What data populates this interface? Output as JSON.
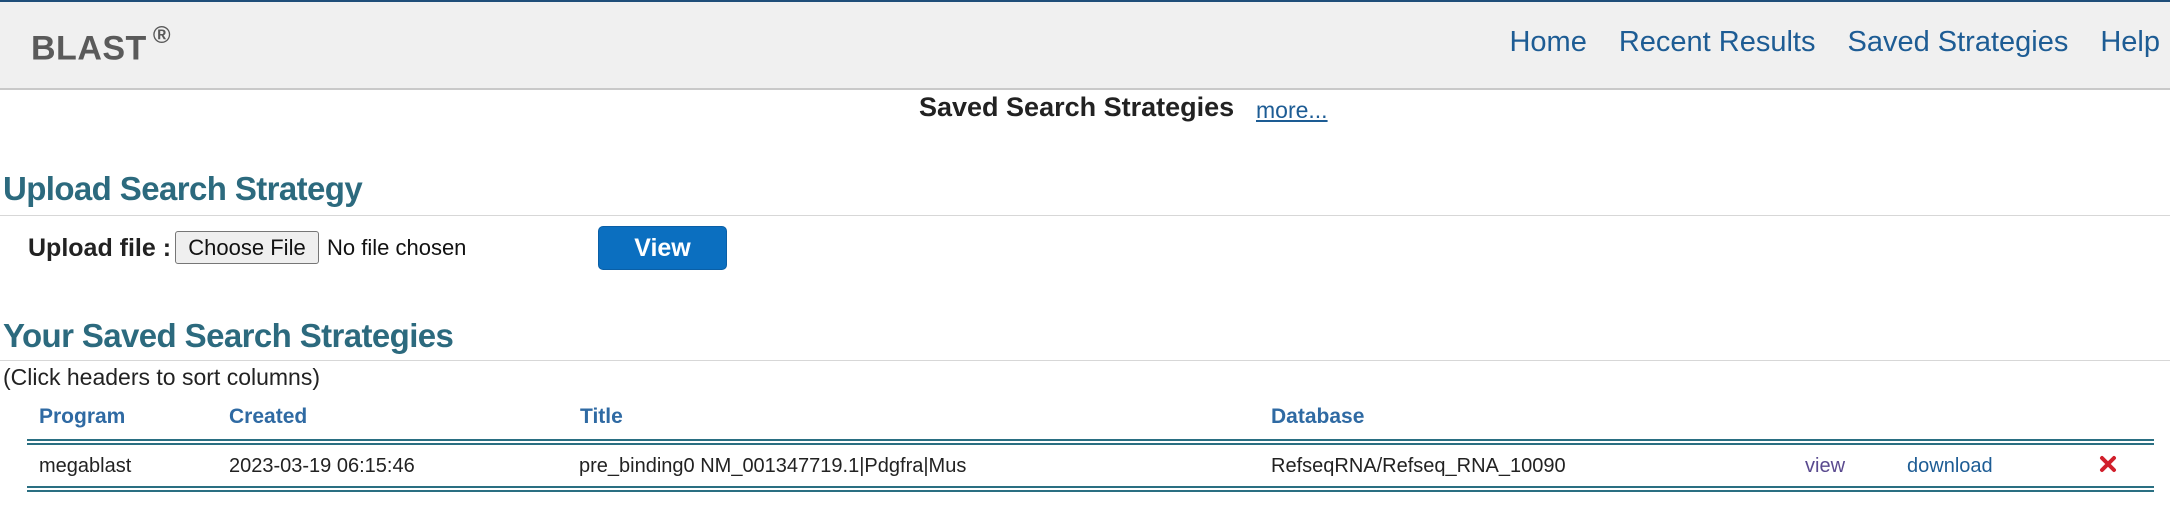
{
  "header": {
    "logo_text": "BLAST",
    "logo_mark": "®",
    "nav": [
      "Home",
      "Recent Results",
      "Saved Strategies",
      "Help"
    ]
  },
  "saved": {
    "title": "Saved Search Strategies",
    "more_link": "more..."
  },
  "upload": {
    "heading": "Upload Search Strategy",
    "label": "Upload file :",
    "choose_button": "Choose File",
    "file_status": "No file chosen",
    "view_button": "View"
  },
  "strategies": {
    "heading": "Your Saved Search Strategies",
    "hint": "(Click headers to sort columns)",
    "columns": [
      "Program",
      "Created",
      "Title",
      "Database"
    ],
    "rows": [
      {
        "program": "megablast",
        "created": "2023-03-19 06:15:46",
        "title": "pre_binding0 NM_001347719.1|Pdgfra|Mus",
        "database": "RefseqRNA/Refseq_RNA_10090",
        "view_link": "view",
        "download_link": "download",
        "delete_icon": "close-x-icon"
      }
    ]
  },
  "colors": {
    "heading": "#2c6a7e",
    "link": "#1d5c94",
    "button": "#0b6fc0",
    "delete": "#d11f2b"
  }
}
